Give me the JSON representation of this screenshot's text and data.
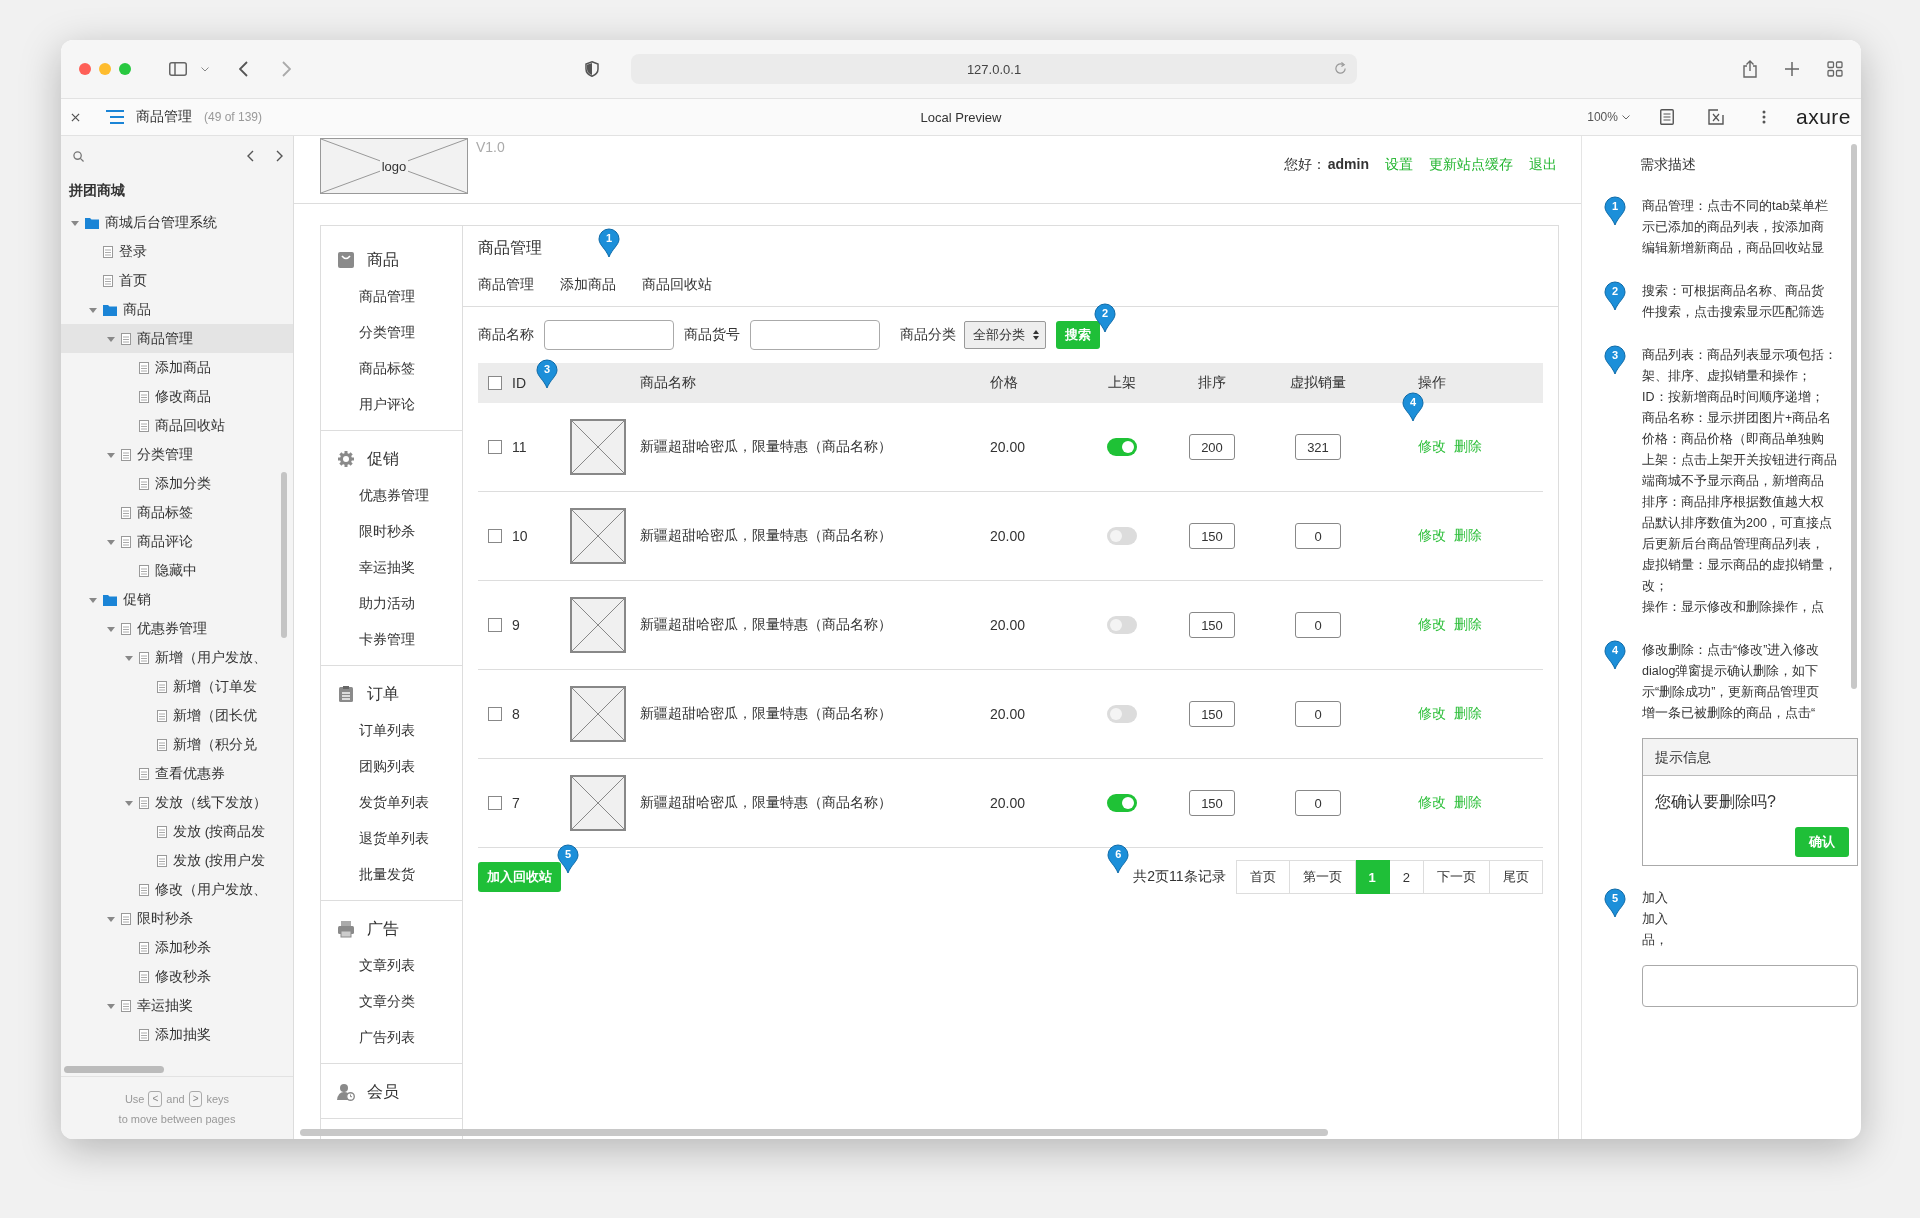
{
  "browser": {
    "address": "127.0.0.1"
  },
  "preview_bar": {
    "page_title": "商品管理",
    "page_count": "(49 of 139)",
    "title": "Local Preview",
    "zoom": "100%",
    "logo": "axure"
  },
  "sidebar": {
    "project": "拼团商城",
    "tree": [
      {
        "label": "商城后台管理系统",
        "kind": "folder",
        "selected": false,
        "expanded": true,
        "children": [
          {
            "label": "登录",
            "kind": "page",
            "selected": false
          },
          {
            "label": "首页",
            "kind": "page",
            "selected": false
          },
          {
            "label": "商品",
            "kind": "folder",
            "selected": false,
            "expanded": true,
            "children": [
              {
                "label": "商品管理",
                "kind": "page",
                "selected": true,
                "expanded": true,
                "children": [
                  {
                    "label": "添加商品",
                    "kind": "page",
                    "selected": false
                  },
                  {
                    "label": "修改商品",
                    "kind": "page",
                    "selected": false
                  },
                  {
                    "label": "商品回收站",
                    "kind": "page",
                    "selected": false
                  }
                ]
              },
              {
                "label": "分类管理",
                "kind": "page",
                "selected": false,
                "expanded": true,
                "children": [
                  {
                    "label": "添加分类",
                    "kind": "page",
                    "selected": false
                  }
                ]
              },
              {
                "label": "商品标签",
                "kind": "page",
                "selected": false
              },
              {
                "label": "商品评论",
                "kind": "page",
                "selected": false,
                "expanded": true,
                "children": [
                  {
                    "label": "隐藏中",
                    "kind": "page",
                    "selected": false
                  }
                ]
              }
            ]
          },
          {
            "label": "促销",
            "kind": "folder",
            "selected": false,
            "expanded": true,
            "children": [
              {
                "label": "优惠券管理",
                "kind": "page",
                "selected": false,
                "expanded": true,
                "children": [
                  {
                    "label": "新增（用户发放、",
                    "kind": "page",
                    "selected": false,
                    "expanded": true,
                    "children": [
                      {
                        "label": "新增（订单发",
                        "kind": "page",
                        "selected": false
                      },
                      {
                        "label": "新增（团长优",
                        "kind": "page",
                        "selected": false
                      },
                      {
                        "label": "新增（积分兑",
                        "kind": "page",
                        "selected": false
                      }
                    ]
                  },
                  {
                    "label": "查看优惠券",
                    "kind": "page",
                    "selected": false
                  },
                  {
                    "label": "发放（线下发放）",
                    "kind": "page",
                    "selected": false,
                    "expanded": true,
                    "children": [
                      {
                        "label": "发放 (按商品发",
                        "kind": "page",
                        "selected": false
                      },
                      {
                        "label": "发放 (按用户发",
                        "kind": "page",
                        "selected": false
                      }
                    ]
                  },
                  {
                    "label": "修改（用户发放、",
                    "kind": "page",
                    "selected": false
                  }
                ]
              },
              {
                "label": "限时秒杀",
                "kind": "page",
                "selected": false,
                "expanded": true,
                "children": [
                  {
                    "label": "添加秒杀",
                    "kind": "page",
                    "selected": false
                  },
                  {
                    "label": "修改秒杀",
                    "kind": "page",
                    "selected": false
                  }
                ]
              },
              {
                "label": "幸运抽奖",
                "kind": "page",
                "selected": false,
                "expanded": true,
                "children": [
                  {
                    "label": "添加抽奖",
                    "kind": "page",
                    "selected": false
                  }
                ]
              }
            ]
          }
        ]
      }
    ],
    "footer": {
      "use": "Use",
      "prev_key": "<",
      "and": "and",
      "next_key": ">",
      "keys": "keys",
      "hint": "to move between pages"
    }
  },
  "header": {
    "logo": "logo",
    "version": "V1.0",
    "greeting": "您好：",
    "user": "admin",
    "links": [
      "设置",
      "更新站点缓存",
      "退出"
    ]
  },
  "menu": [
    {
      "title": "商品",
      "kind": "goods",
      "items": [
        "商品管理",
        "分类管理",
        "商品标签",
        "用户评论"
      ]
    },
    {
      "title": "促销",
      "kind": "promo",
      "items": [
        "优惠券管理",
        "限时秒杀",
        "幸运抽奖",
        "助力活动",
        "卡券管理"
      ]
    },
    {
      "title": "订单",
      "kind": "order",
      "items": [
        "订单列表",
        "团购列表",
        "发货单列表",
        "退货单列表",
        "批量发货"
      ]
    },
    {
      "title": "广告",
      "kind": "ad",
      "items": [
        "文章列表",
        "文章分类",
        "广告列表"
      ]
    },
    {
      "title": "会员",
      "kind": "member"
    }
  ],
  "content": {
    "title": "商品管理",
    "title_marker": "1",
    "tabs": [
      "商品管理",
      "添加商品",
      "商品回收站"
    ],
    "search": {
      "name_label": "商品名称",
      "code_label": "商品货号",
      "category_label": "商品分类",
      "category": "全部分类",
      "button": "搜索",
      "marker": "2"
    },
    "table": {
      "marker": "3",
      "checked": false,
      "columns": [
        "ID",
        "商品名称",
        "价格",
        "上架",
        "排序",
        "虚拟销量",
        "操作"
      ],
      "rows": [
        {
          "checked": false,
          "id": "11",
          "name": "新疆超甜哈密瓜，限量特惠（商品名称）",
          "price": "20.00",
          "on": true,
          "sort": "200",
          "virtual_sales": "321",
          "actions": [
            "修改",
            "删除"
          ],
          "marker": "4"
        },
        {
          "checked": false,
          "id": "10",
          "name": "新疆超甜哈密瓜，限量特惠（商品名称）",
          "price": "20.00",
          "on": false,
          "sort": "150",
          "virtual_sales": "0",
          "actions": [
            "修改",
            "删除"
          ]
        },
        {
          "checked": false,
          "id": "9",
          "name": "新疆超甜哈密瓜，限量特惠（商品名称）",
          "price": "20.00",
          "on": false,
          "sort": "150",
          "virtual_sales": "0",
          "actions": [
            "修改",
            "删除"
          ]
        },
        {
          "checked": false,
          "id": "8",
          "name": "新疆超甜哈密瓜，限量特惠（商品名称）",
          "price": "20.00",
          "on": false,
          "sort": "150",
          "virtual_sales": "0",
          "actions": [
            "修改",
            "删除"
          ]
        },
        {
          "checked": false,
          "id": "7",
          "name": "新疆超甜哈密瓜，限量特惠（商品名称）",
          "price": "20.00",
          "on": true,
          "sort": "150",
          "virtual_sales": "0",
          "actions": [
            "修改",
            "删除"
          ]
        }
      ]
    },
    "footer": {
      "button": "加入回收站",
      "button_marker": "5",
      "pager_marker": "6",
      "summary": "共2页11条记录",
      "pages": [
        {
          "label": "首页",
          "selected": false
        },
        {
          "label": "第一页",
          "selected": false
        },
        {
          "label": "1",
          "selected": true
        },
        {
          "label": "2",
          "selected": false
        },
        {
          "label": "下一页",
          "selected": false
        },
        {
          "label": "尾页",
          "selected": false
        }
      ]
    }
  },
  "notes": {
    "title": "需求描述",
    "items": [
      {
        "marker": "1",
        "kind": "text",
        "lines": [
          "商品管理：点击不同的tab菜单栏",
          "示已添加的商品列表，按添加商",
          "编辑新增新商品，商品回收站显"
        ]
      },
      {
        "marker": "2",
        "kind": "text",
        "lines": [
          "搜索：可根据商品名称、商品货",
          "件搜索，点击搜索显示匹配筛选"
        ]
      },
      {
        "marker": "3",
        "kind": "text",
        "lines": [
          "商品列表：商品列表显示项包括：",
          "架、排序、虚拟销量和操作；",
          "ID：按新增商品时间顺序递增；",
          "商品名称：显示拼团图片+商品名",
          "价格：商品价格（即商品单独购",
          "上架：点击上架开关按钮进行商品",
          "端商城不予显示商品，新增商品",
          "排序：商品排序根据数值越大权",
          "品默认排序数值为200，可直接点",
          "后更新后台商品管理商品列表，",
          "虚拟销量：显示商品的虚拟销量，",
          "改；",
          "操作：显示修改和删除操作，点"
        ]
      },
      {
        "marker": "4",
        "kind": "dialog",
        "lines": [
          "修改删除：点击“修改”进入修改",
          "dialog弹窗提示确认删除，如下",
          "示“删除成功”，更新商品管理页",
          "增一条已被删除的商品，点击“"
        ],
        "dialog": {
          "title": "提示信息",
          "message": "您确认要删除吗?",
          "button": "确认"
        }
      },
      {
        "marker": "5",
        "kind": "message-box",
        "lines": [
          "加入",
          "加入",
          "品，"
        ]
      }
    ]
  }
}
